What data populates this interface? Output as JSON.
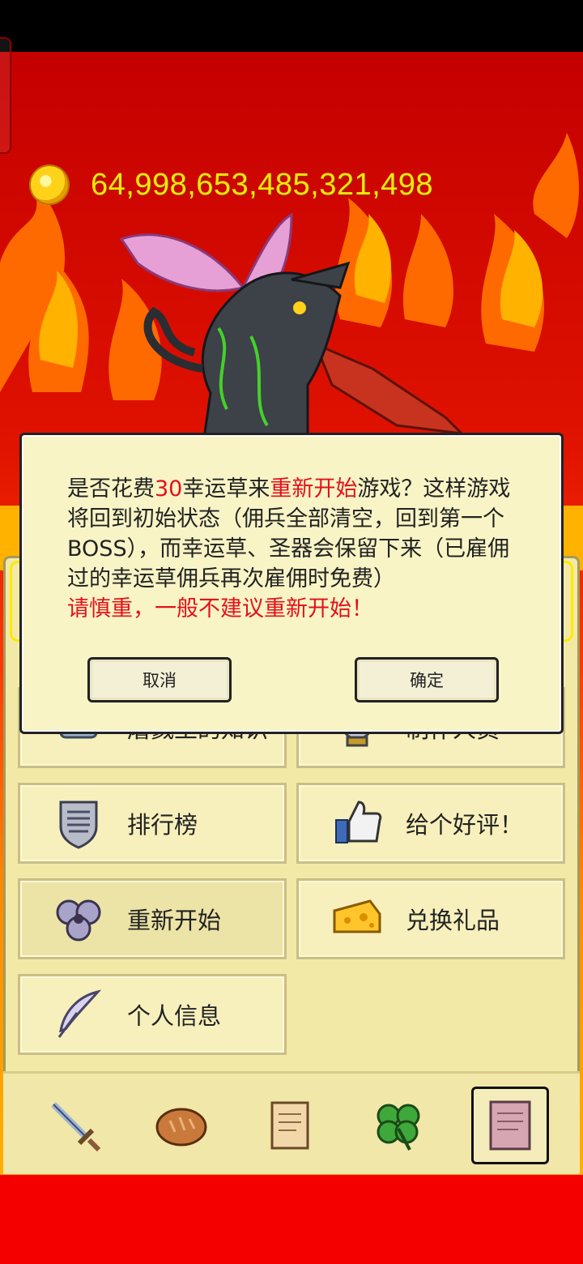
{
  "hud": {
    "coins": "64,998,653,485,321,498"
  },
  "dialog": {
    "message": {
      "part1": "是否花费",
      "cost": "30",
      "part2": "幸运草来",
      "action": "重新开始",
      "part3": "游戏？这样游戏将回到初始状态（佣兵全部清空，回到第一个BOSS），而幸运草、圣器会保留下来（已雇佣过的幸运草佣兵再次雇佣时免费）"
    },
    "warning": "请慎重，一般不建议重新开始！",
    "cancel_label": "取消",
    "confirm_label": "确定"
  },
  "menu": {
    "items": [
      {
        "label": "屠戮王的知识",
        "icon": "scroll-icon"
      },
      {
        "label": "制作人员",
        "icon": "crystal-ball-icon"
      },
      {
        "label": "排行榜",
        "icon": "shield-icon"
      },
      {
        "label": "给个好评！",
        "icon": "thumbs-up-icon"
      },
      {
        "label": "重新开始",
        "icon": "triskele-icon"
      },
      {
        "label": "兑换礼品",
        "icon": "cheese-icon"
      },
      {
        "label": "个人信息",
        "icon": "feather-icon"
      }
    ]
  },
  "tabs": [
    {
      "icon": "sword-icon"
    },
    {
      "icon": "bread-icon"
    },
    {
      "icon": "scroll-icon"
    },
    {
      "icon": "clover-icon"
    },
    {
      "icon": "book-icon",
      "selected": true
    }
  ],
  "colors": {
    "highlight": "#e4101a",
    "coin_text": "#ffe60a",
    "panel": "#f3e9a6"
  }
}
